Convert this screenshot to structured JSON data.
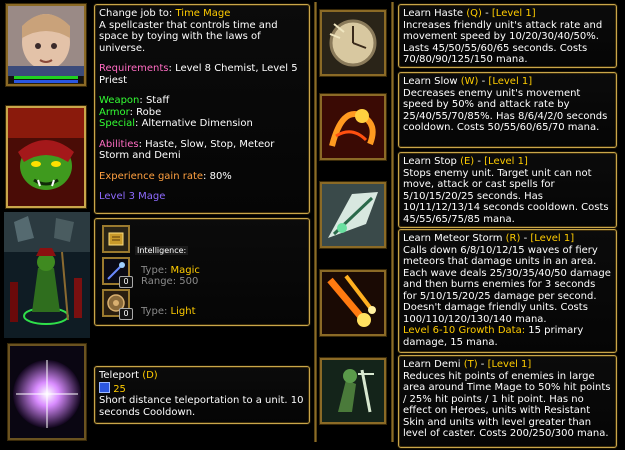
{
  "job": {
    "header_label": "Change job to:",
    "job_name": "Time Mage",
    "description": "A spellcaster that controls time and space by toying with the laws of universe.",
    "requirements_label": "Requirements",
    "requirements_value": ": Level 8 Chemist, Level 5 Priest",
    "weapon_label": "Weapon",
    "weapon_value": ": Staff",
    "armor_label": "Armor",
    "armor_value": ": Robe",
    "special_label": "Special",
    "special_value": ": Alternative Dimension",
    "abilities_label": "Abilities",
    "abilities_value": ": Haste, Slow, Stop, Meteor Storm and Demi",
    "exp_label": "Experience gain rate",
    "exp_value": ": 80%",
    "level_label": "Level 3 Mage"
  },
  "stats": {
    "primary_label": "Intelligence:",
    "type_label": "Type:",
    "attack_type": "Magic",
    "range_label": "Range:",
    "range_value": "500",
    "armor_type_label": "Type:",
    "armor_type": "Light",
    "slot_counts": [
      "0",
      "0"
    ]
  },
  "teleport": {
    "title": "Teleport",
    "hotkey": "(D)",
    "mana": "25",
    "text": "Short distance teleportation to a unit. 10 seconds Cooldown."
  },
  "abilities": [
    {
      "learn": "Learn Haste",
      "hotkey": "(Q)",
      "level": "[Level 1]",
      "text": "Increases friendly unit's attack rate and movement speed by 10/20/30/40/50%. Lasts 45/50/55/60/65 seconds. Costs 70/80/90/125/150 mana."
    },
    {
      "learn": "Learn Slow",
      "hotkey": "(W)",
      "level": "[Level 1]",
      "text": "Decreases enemy unit's movement speed by 50% and attack rate by 25/40/55/70/85%. Has 8/6/4/2/0 seconds cooldown. Costs 50/55/60/65/70 mana."
    },
    {
      "learn": "Learn Stop",
      "hotkey": "(E)",
      "level": "[Level 1]",
      "text": "Stops enemy unit. Target unit can not move, attack or cast spells for 5/10/15/20/25 seconds. Has 10/11/12/13/14 seconds cooldown. Costs 45/55/65/75/85 mana."
    },
    {
      "learn": "Learn Meteor Storm",
      "hotkey": "(R)",
      "level": "[Level 1]",
      "text": "Calls down 6/8/10/12/15 waves of fiery meteors that damage units in an area. Each wave deals 25/30/35/40/50 damage and then burns enemies for 3 seconds for 5/10/15/20/25 damage per second. Doesn't damage friendly units. Costs 100/110/120/130/140 mana.",
      "growth_label": "Level 6-10 Growth Data:",
      "growth_value": " 15 primary damage, 15 mana."
    },
    {
      "learn": "Learn Demi",
      "hotkey": "(T)",
      "level": "[Level 1]",
      "text": "Reduces hit points of enemies in large area around Time Mage to 50% hit points / 25% hit points / 1 hit point. Has no effect on Heroes, units with Resistant Skin and units with level greater than level of caster. Costs 200/250/300 mana."
    }
  ],
  "colors": {
    "gold": "#ffcc00",
    "border": "#c9a64a",
    "pink": "#ff6cc2",
    "green": "#33ff33",
    "orange": "#ffa040",
    "purple": "#8f6bff"
  }
}
